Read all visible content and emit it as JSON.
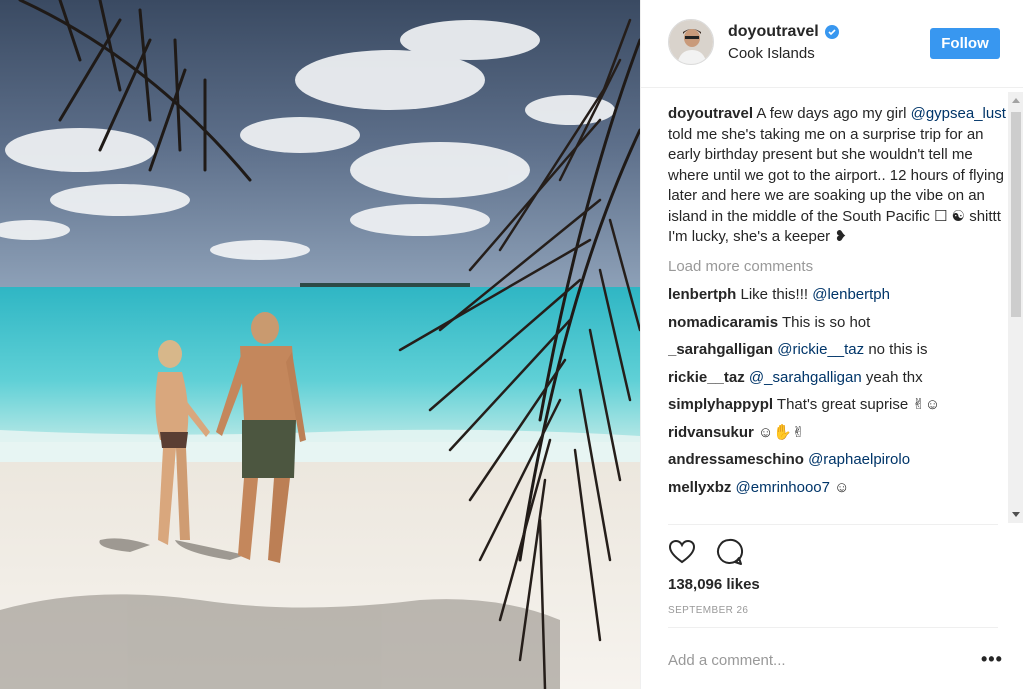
{
  "post": {
    "username": "doyoutravel",
    "location": "Cook Islands",
    "follow_label": "Follow"
  },
  "caption": {
    "username": "doyoutravel",
    "text_before": " A few days ago my girl ",
    "mention": "@gypsea_lust",
    "text_after": " told me she's taking me on a surprise trip for an early birthday present but she wouldn't tell me where until we got to the airport.. 12 hours of flying later and here we are soaking up the vibe on an island in the middle of the South Pacific ☐ ☯ shittt I'm lucky, she's a keeper ❥"
  },
  "load_more_label": "Load more comments",
  "comments": [
    {
      "user": "lenbertph",
      "text": " Like this!!! ",
      "mention": "@lenbertph",
      "tail": ""
    },
    {
      "user": "nomadicaramis",
      "text": " This is so hot",
      "mention": "",
      "tail": ""
    },
    {
      "user": "_sarahgalligan",
      "text": " ",
      "mention": "@rickie__taz",
      "tail": " no this is"
    },
    {
      "user": "rickie__taz",
      "text": " ",
      "mention": "@_sarahgalligan",
      "tail": " yeah thx"
    },
    {
      "user": "simplyhappypl",
      "text": " That's great suprise ✌☺",
      "mention": "",
      "tail": ""
    },
    {
      "user": "ridvansukur",
      "text": " ☺✋✌",
      "mention": "",
      "tail": ""
    },
    {
      "user": "andressameschino",
      "text": " ",
      "mention": "@raphaelpirolo",
      "tail": ""
    },
    {
      "user": "mellyxbz",
      "text": " ",
      "mention": "@emrinhooo7",
      "tail": " ☺"
    }
  ],
  "likes_label": "138,096 likes",
  "date_label": "SEPTEMBER 26",
  "add_comment_placeholder": "Add a comment...",
  "more_label": "•••",
  "colors": {
    "accent": "#3897f0",
    "mention": "#003569",
    "muted": "#999999"
  },
  "icons": [
    "verified-badge-icon",
    "heart-icon",
    "comment-icon",
    "more-options-icon"
  ]
}
